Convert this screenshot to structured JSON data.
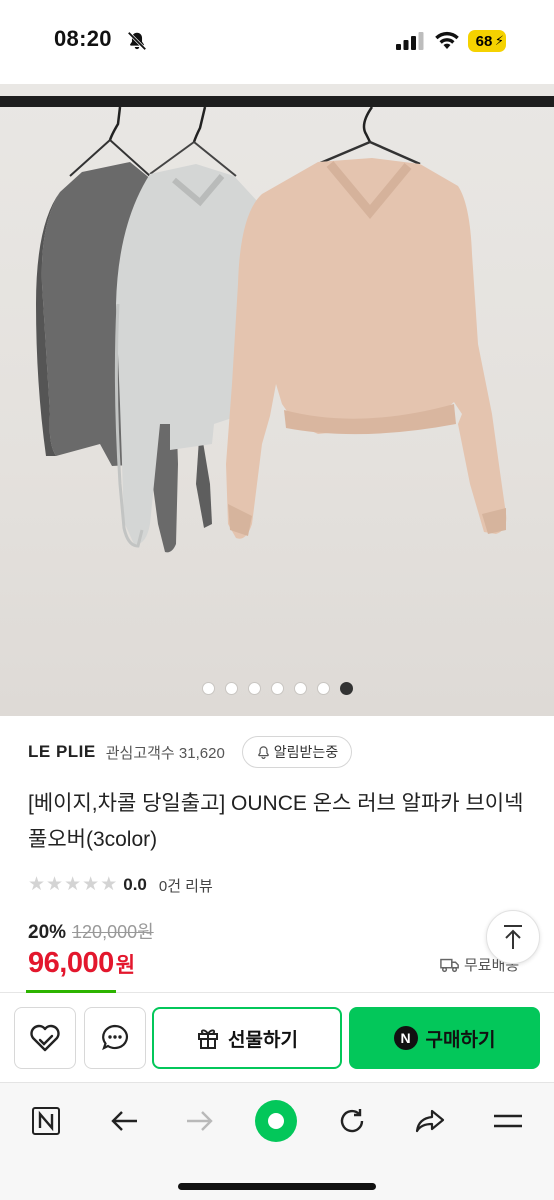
{
  "status_bar": {
    "time": "08:20",
    "battery": "68",
    "icons": [
      "bell-off-icon",
      "signal-icon",
      "wifi-icon",
      "battery-icon"
    ]
  },
  "gallery": {
    "image_count": 7,
    "active_index": 6
  },
  "store": {
    "name": "LE PLIE",
    "fans": "관심고객수 31,620",
    "alarm_label": "알림받는중"
  },
  "product": {
    "title": "[베이지,차콜 당일출고] OUNCE 온스 러브 알파카 브이넥 풀오버(3color)",
    "rating": "0.0",
    "rating_stars": 0,
    "review_count": "0건 리뷰",
    "discount": "20%",
    "original_price": "120,000원",
    "price": "96,000",
    "currency": "원",
    "shipping": "무료배송"
  },
  "actions": {
    "gift_label": "선물하기",
    "buy_label": "구매하기",
    "buy_badge": "N"
  },
  "colors": {
    "accent_green": "#03c75a",
    "price_red": "#e3172d"
  },
  "browser_nav": [
    "naver-home-icon",
    "back-icon",
    "forward-icon",
    "green-dot-icon",
    "reload-icon",
    "share-icon",
    "menu-icon"
  ]
}
